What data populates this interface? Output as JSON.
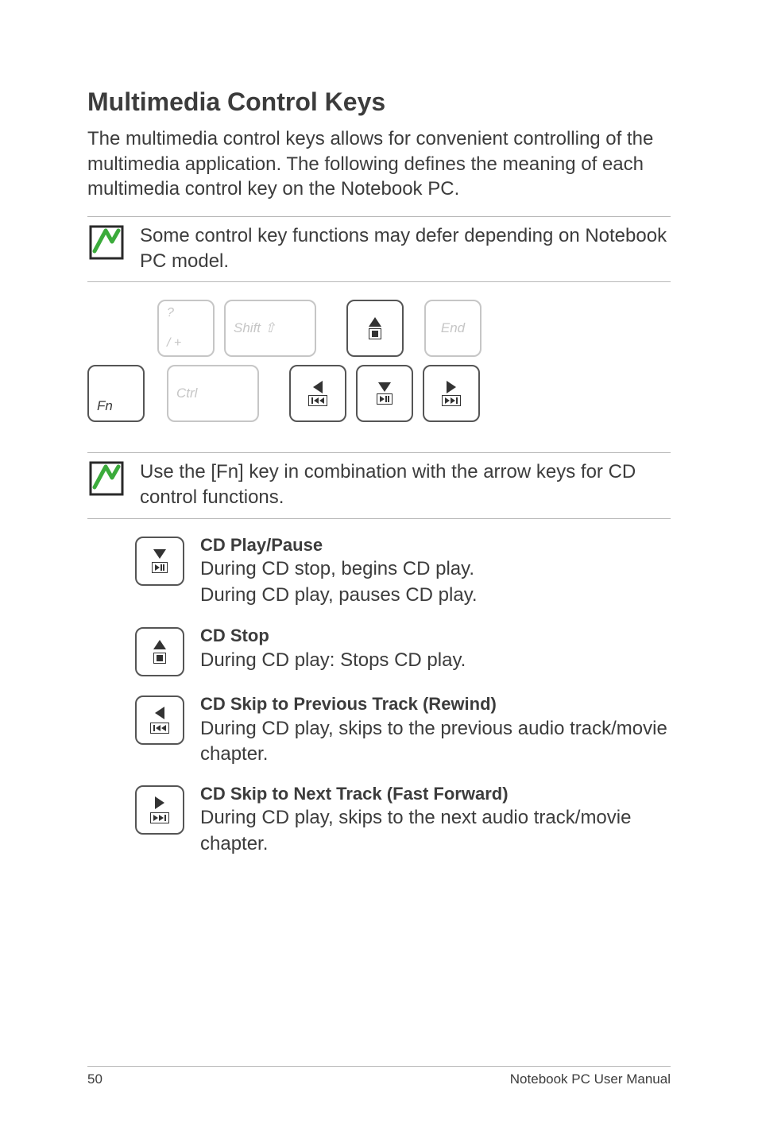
{
  "title": "Multimedia Control Keys",
  "intro": "The multimedia control keys allows for convenient controlling of the multimedia application. The following defines the meaning of each multimedia control key on the Notebook PC.",
  "note1": "Some control key functions may defer depending on Notebook PC model.",
  "note2": "Use the [Fn] key in combination with the arrow keys for CD control functions.",
  "keys": {
    "fn": "Fn",
    "slash_top": "?",
    "slash_bottom": "/   +",
    "shift": "Shift ⇧",
    "end": "End",
    "ctrl": "Ctrl"
  },
  "descs": {
    "playpause": {
      "title": "CD Play/Pause",
      "l1": "During CD stop, begins CD play.",
      "l2": "During CD play, pauses CD play."
    },
    "stop": {
      "title": "CD Stop",
      "l1": "During CD play: Stops CD play."
    },
    "prev": {
      "title": "CD Skip to Previous Track (Rewind)",
      "l1": "During CD play, skips to the previous audio track/movie chapter."
    },
    "next": {
      "title": "CD Skip to Next Track (Fast Forward)",
      "l1": "During CD play, skips to the next audio track/movie chapter."
    }
  },
  "footer": {
    "page": "50",
    "manual": "Notebook PC User Manual"
  }
}
